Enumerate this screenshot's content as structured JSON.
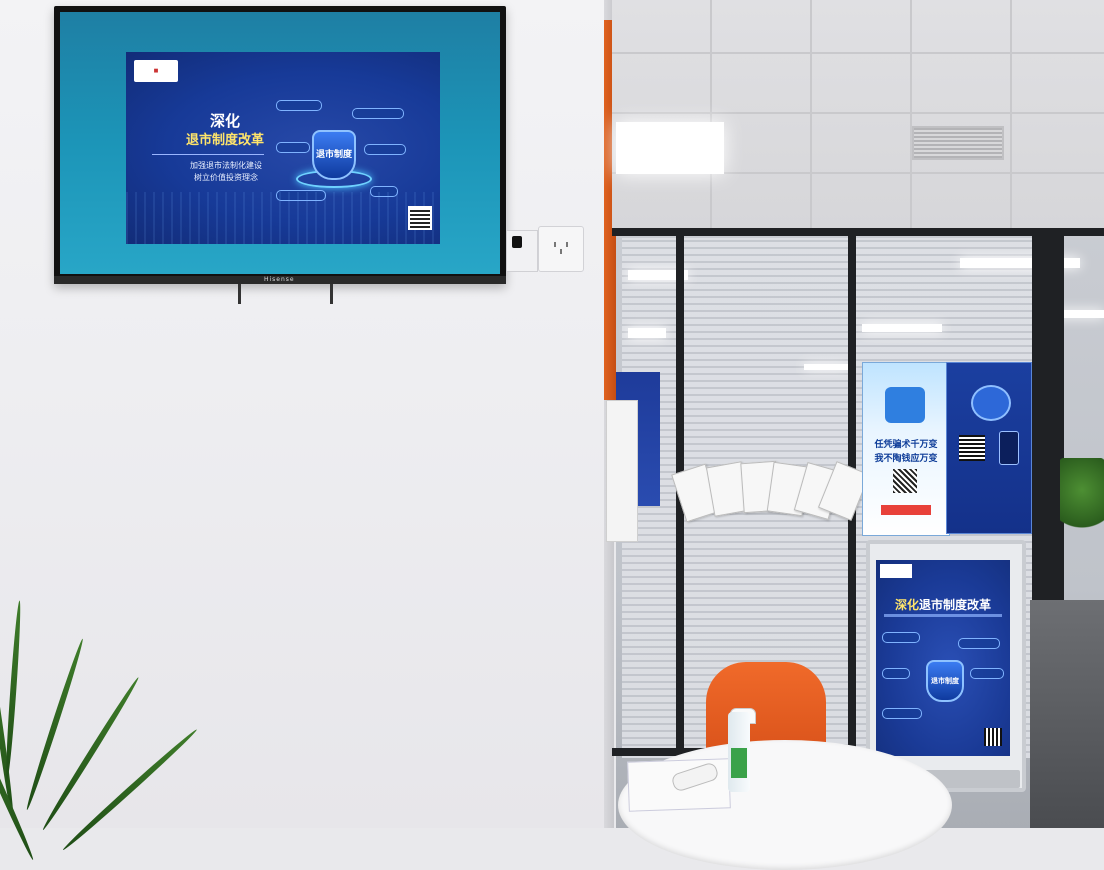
{
  "scene": {
    "description_colors": {
      "wall": "#eeeef1",
      "tv_screen": "#1c95b8",
      "slide_bg": "#173a98",
      "accent_orange": "#e0621f",
      "chair": "#f06a2a"
    }
  },
  "tv": {
    "brand": "Hisense",
    "slide": {
      "title_line1": "深化",
      "title_line2": "退市制度改革",
      "subtitle_line1": "加强退市法制化建设",
      "subtitle_line2": "树立价值投资理念",
      "shield_text": "退市制度"
    }
  },
  "standing_sign": {
    "title_part1": "深化",
    "title_part2": "退市制度改革",
    "shield_text": "退市制度"
  },
  "poster_a": {
    "line1": "任凭骗术千万变",
    "line2": "我不陶钱应万变"
  }
}
